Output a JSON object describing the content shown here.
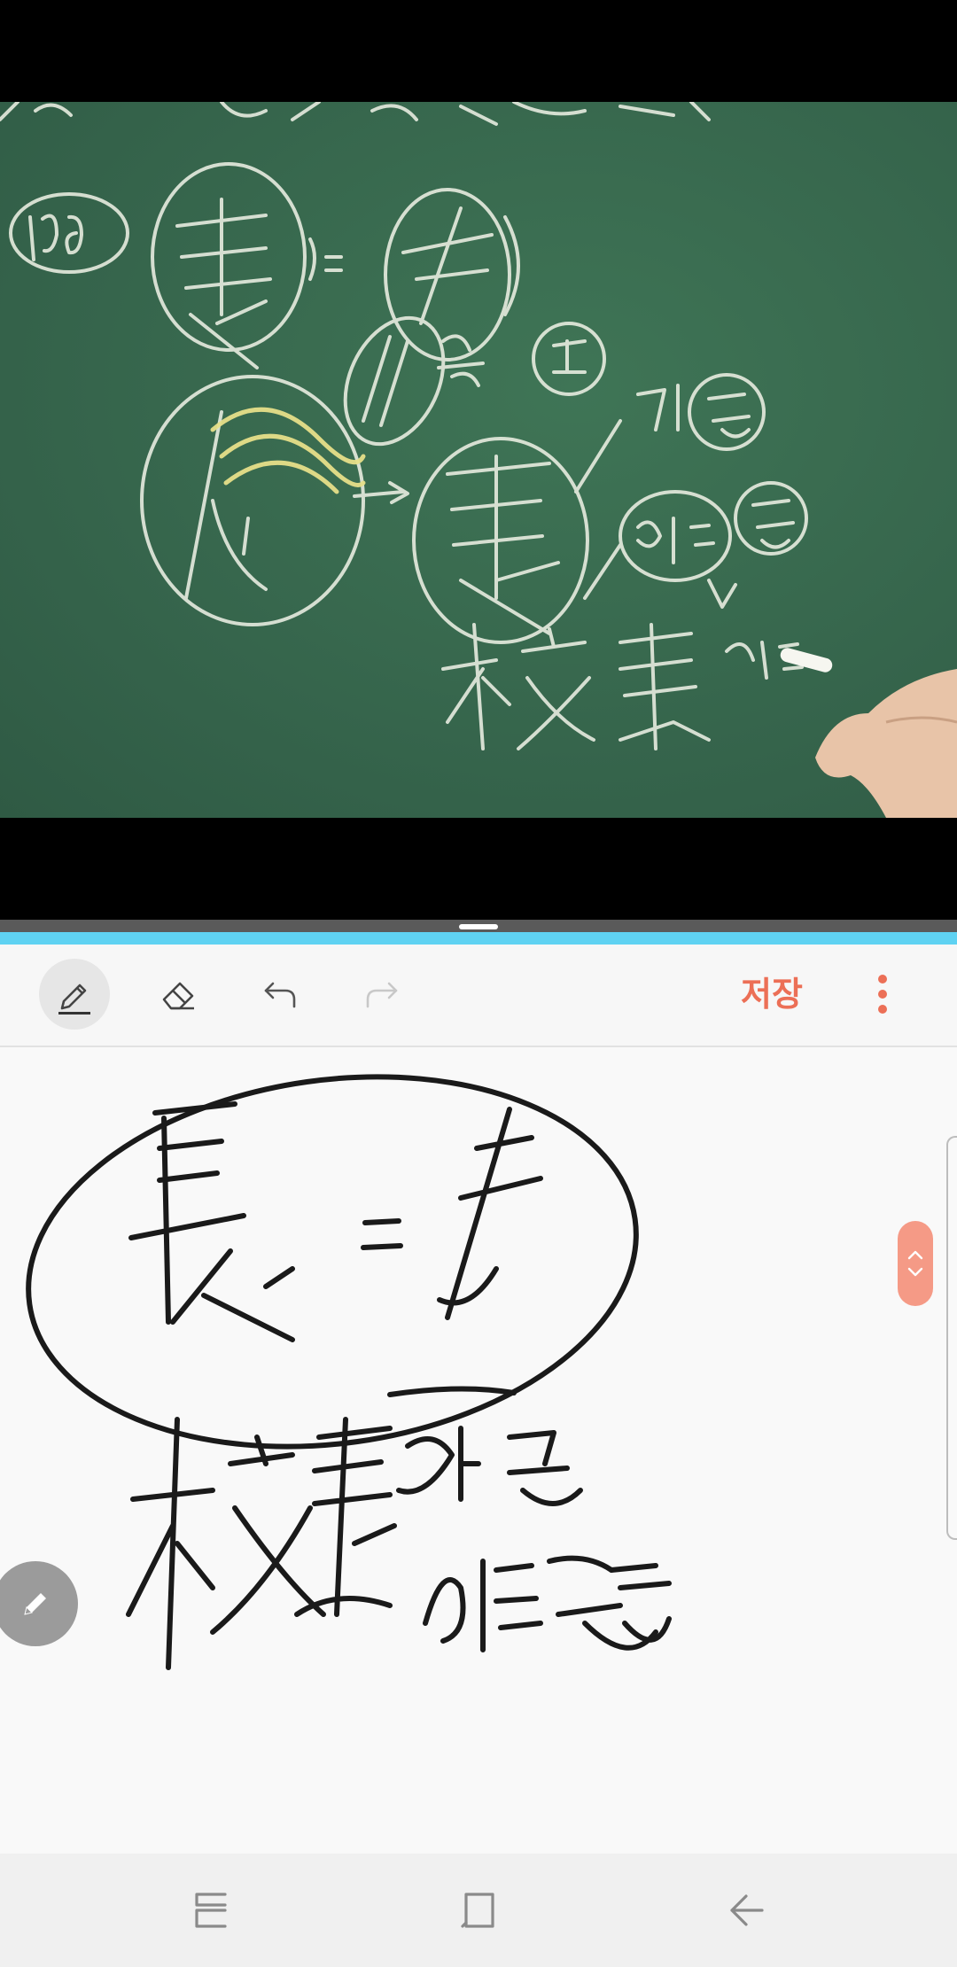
{
  "video": {
    "frame": "chalkboard-lecture",
    "board_color": "#3a6b4f"
  },
  "note_toolbar": {
    "pen_icon": "pen-icon",
    "eraser_icon": "eraser-icon",
    "undo_icon": "undo-icon",
    "redo_icon": "redo-icon",
    "save_label": "저장",
    "more_icon": "more-vertical-icon",
    "accent_color": "#ec6f56"
  },
  "note_canvas": {
    "ink_color": "#1a1a1a",
    "scroll_icons": [
      "chevron-up-icon",
      "chevron-down-icon"
    ],
    "fab_icon": "pencil-icon"
  },
  "nav_bar": {
    "recents_icon": "recents-icon",
    "home_icon": "home-icon",
    "back_icon": "back-icon"
  },
  "colors": {
    "split_accent": "#5fd2f2"
  }
}
